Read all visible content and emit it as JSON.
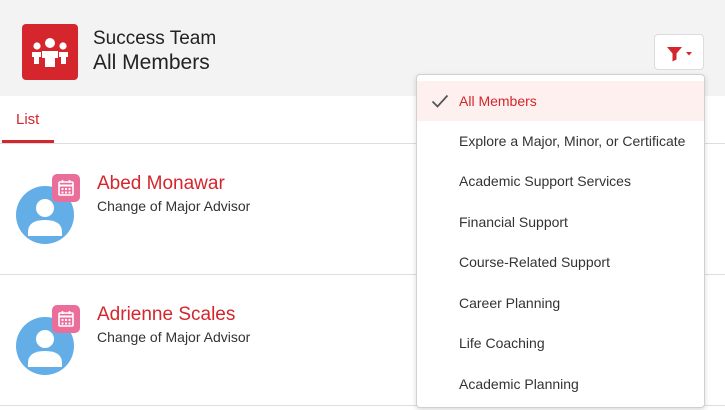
{
  "header": {
    "team_name": "Success Team",
    "view_name": "All Members",
    "team_icon": "team-people-icon",
    "filter_icon": "filter-funnel-icon"
  },
  "tabs": [
    {
      "label": "List",
      "active": true
    }
  ],
  "members": [
    {
      "name": "Abed Monawar",
      "role": "Change of Major Advisor",
      "avatar_icon": "person-icon",
      "badge_icon": "calendar-icon"
    },
    {
      "name": "Adrienne Scales",
      "role": "Change of Major Advisor",
      "avatar_icon": "person-icon",
      "badge_icon": "calendar-icon"
    }
  ],
  "filter_menu": {
    "selected": "All Members",
    "items": [
      "All Members",
      "Explore a Major, Minor, or Certificate",
      "Academic Support Services",
      "Financial Support",
      "Course-Related Support",
      "Career Planning",
      "Life Coaching",
      "Academic Planning"
    ]
  },
  "colors": {
    "accent": "#d4262c",
    "header_bg": "#f3f3f3",
    "avatar": "#63aee6",
    "calendar_badge": "#e96e9a",
    "selected_item_bg": "#fdf0ef"
  }
}
